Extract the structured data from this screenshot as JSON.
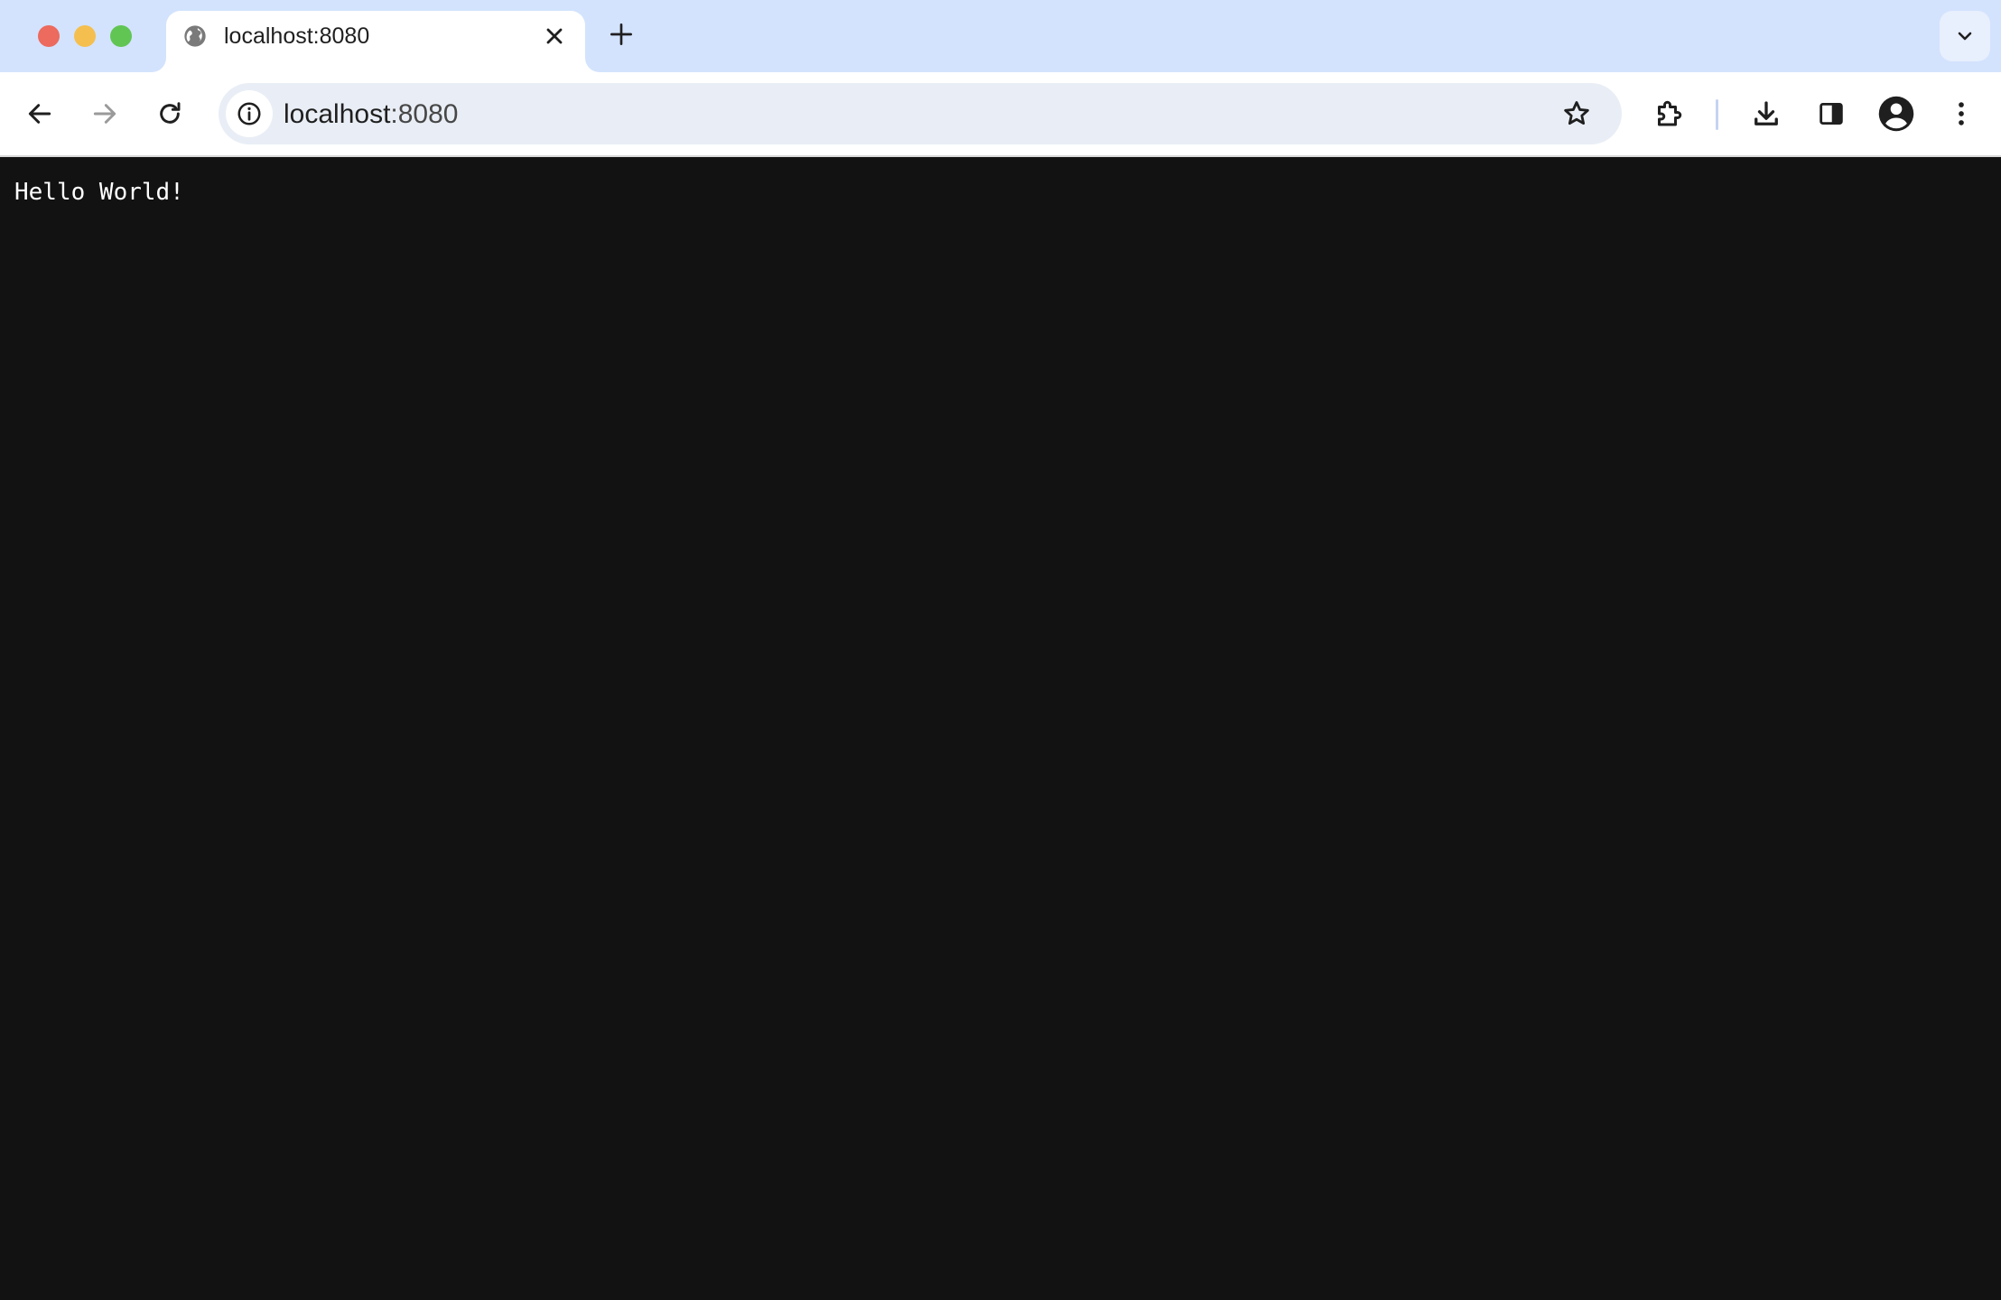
{
  "browser": {
    "tab": {
      "title": "localhost:8080",
      "favicon": "globe-icon"
    },
    "new_tab_icon": "plus-icon",
    "tab_search_icon": "chevron-down-icon",
    "toolbar": {
      "back_icon": "arrow-left-icon",
      "forward_icon": "arrow-right-icon",
      "reload_icon": "reload-icon",
      "extensions_icon": "puzzle-icon",
      "downloads_icon": "download-icon",
      "side_panel_icon": "side-panel-icon",
      "profile_icon": "account-icon",
      "menu_icon": "more-vert-icon"
    },
    "omnibox": {
      "host": "localhost",
      "port": ":8080",
      "site_info_icon": "info-icon",
      "bookmark_icon": "star-icon"
    }
  },
  "page": {
    "text": "Hello World!",
    "background": "#121212",
    "text_color": "#ffffff"
  },
  "colors": {
    "tabstrip": "#d3e3fd",
    "omnibox": "#e9eef6",
    "traffic_red": "#ec6a5e",
    "traffic_yellow": "#f4bf4f",
    "traffic_green": "#61c554"
  }
}
